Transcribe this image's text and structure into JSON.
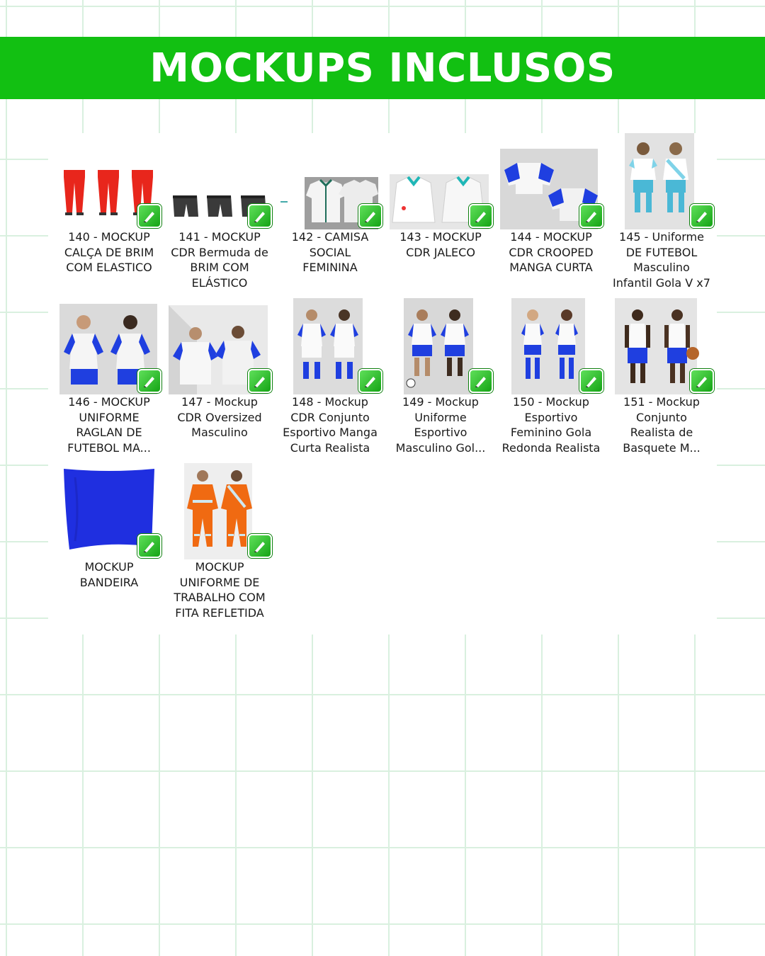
{
  "header": {
    "title": "MOCKUPS INCLUSOS"
  },
  "icons": {
    "file_badge": "coreldraw-file-icon"
  },
  "colors": {
    "banner": "#12c012",
    "grid_line": "#d9f0df",
    "badge_green": "#22b522",
    "royal_blue": "#1f3fe0"
  },
  "files": [
    {
      "label": "140 - MOCKUP\nCALÇA DE BRIM\nCOM ELASTICO"
    },
    {
      "label": "141 - MOCKUP\nCDR Bermuda de\nBRIM COM\nELÁSTICO"
    },
    {
      "label": "142 - CAMISA\nSOCIAL\nFEMININA"
    },
    {
      "label": "143 - MOCKUP\nCDR JALECO"
    },
    {
      "label": "144 - MOCKUP\nCDR CROOPED\nMANGA CURTA"
    },
    {
      "label": "145 - Uniforme\nDE FUTEBOL\nMasculino\nInfantil Gola V x7"
    },
    {
      "label": "146 - MOCKUP\nUNIFORME\nRAGLAN DE\nFUTEBOL MA..."
    },
    {
      "label": "147 - Mockup\nCDR Oversized\nMasculino"
    },
    {
      "label": "148 - Mockup\nCDR Conjunto\nEsportivo Manga\nCurta Realista"
    },
    {
      "label": "149 - Mockup\nUniforme\nEsportivo\nMasculino Gol..."
    },
    {
      "label": "150 - Mockup\nEsportivo\nFeminino Gola\nRedonda Realista"
    },
    {
      "label": "151 - Mockup\nConjunto\nRealista de\nBasquete M..."
    },
    {
      "label": "MOCKUP\nBANDEIRA"
    },
    {
      "label": "MOCKUP\nUNIFORME DE\nTRABALHO COM\nFITA REFLETIDA"
    }
  ]
}
